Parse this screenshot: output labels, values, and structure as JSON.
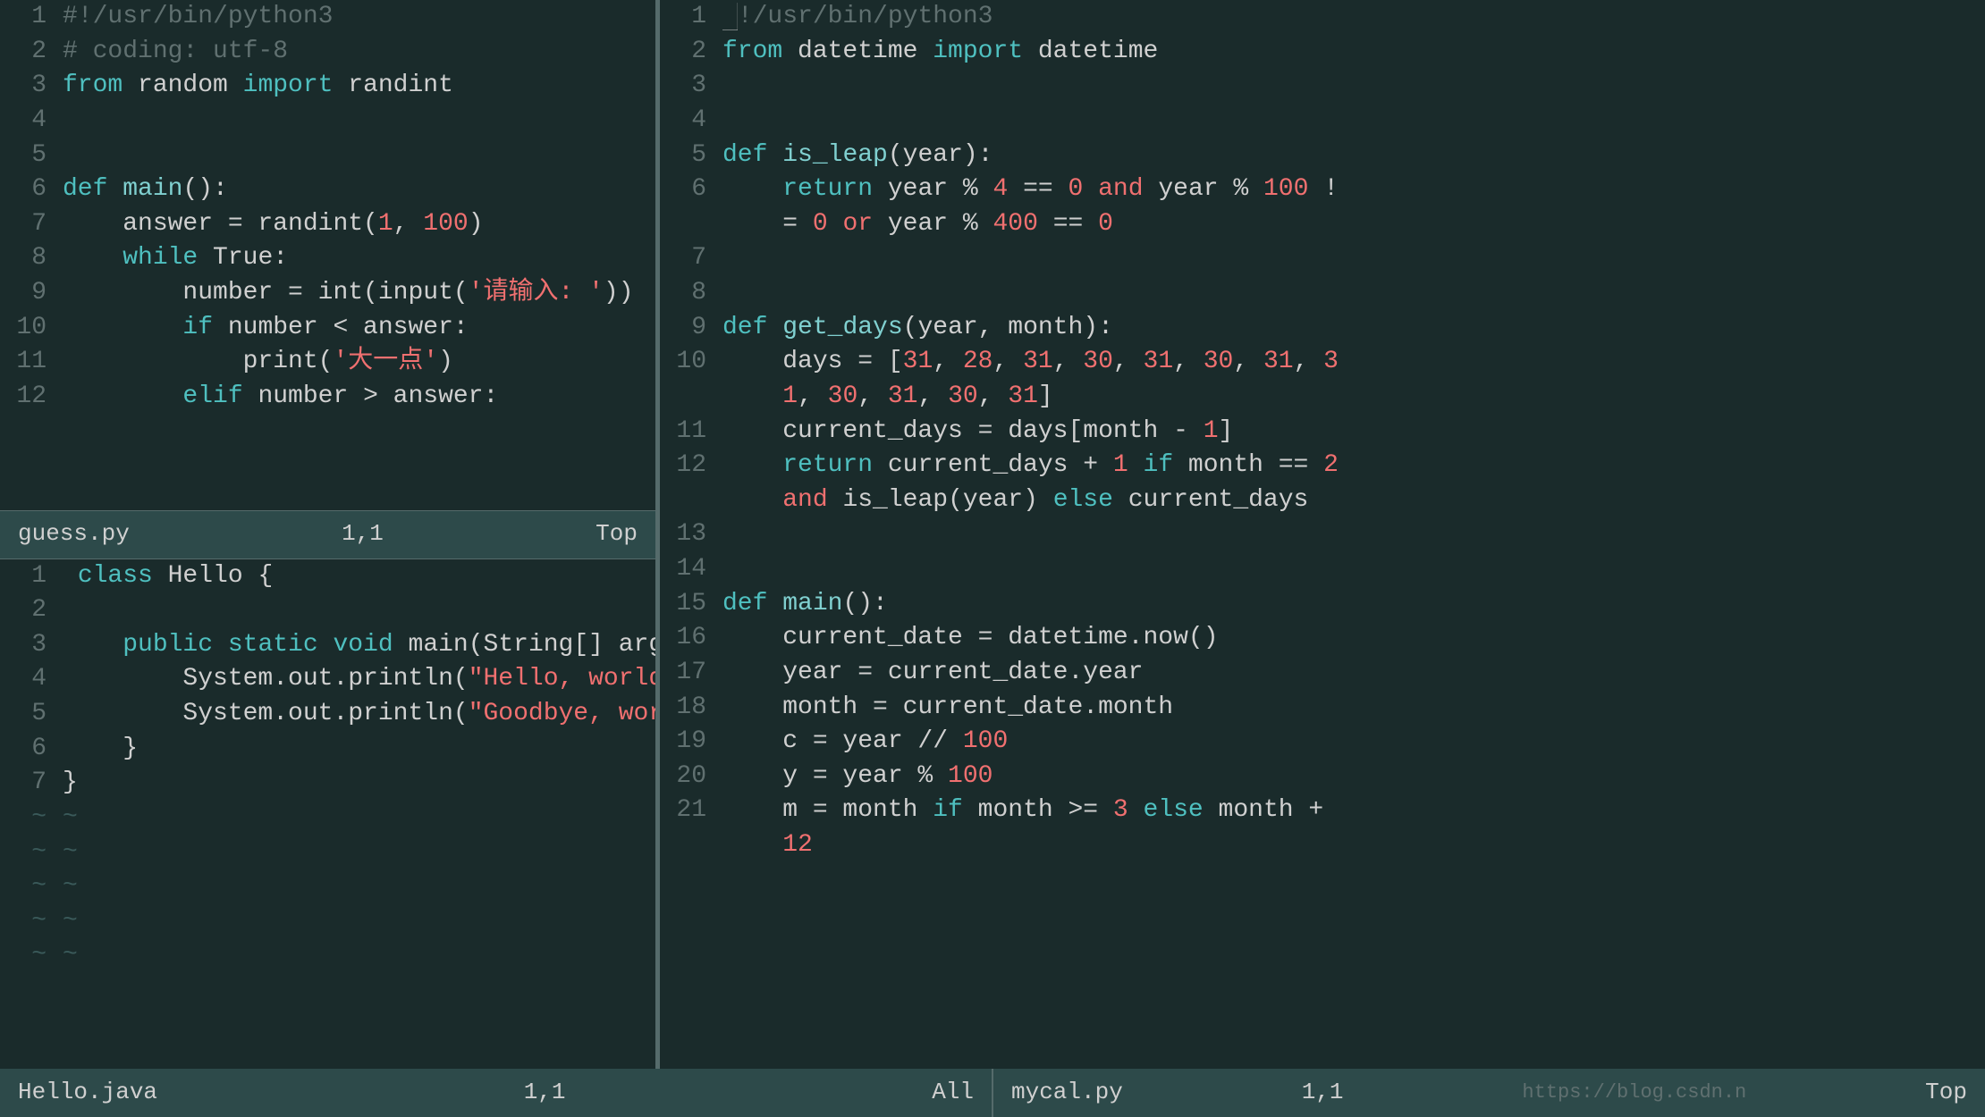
{
  "left_top": {
    "lines": [
      {
        "ln": "1",
        "tokens": [
          {
            "t": "#!/usr/bin/python3",
            "c": "c-shebang"
          }
        ]
      },
      {
        "ln": "2",
        "tokens": [
          {
            "t": "# coding: utf-8",
            "c": "c-comment"
          }
        ]
      },
      {
        "ln": "3",
        "tokens": [
          {
            "t": "from",
            "c": "c-keyword"
          },
          {
            "t": " random ",
            "c": "c-plain"
          },
          {
            "t": "import",
            "c": "c-keyword"
          },
          {
            "t": " randint",
            "c": "c-plain"
          }
        ]
      },
      {
        "ln": "4",
        "tokens": []
      },
      {
        "ln": "5",
        "tokens": []
      },
      {
        "ln": "6",
        "tokens": [
          {
            "t": "def",
            "c": "c-def"
          },
          {
            "t": " ",
            "c": "c-plain"
          },
          {
            "t": "main",
            "c": "c-funcname"
          },
          {
            "t": "():",
            "c": "c-plain"
          }
        ]
      },
      {
        "ln": "7",
        "tokens": [
          {
            "t": "    answer = randint(",
            "c": "c-plain"
          },
          {
            "t": "1",
            "c": "c-number"
          },
          {
            "t": ", ",
            "c": "c-plain"
          },
          {
            "t": "100",
            "c": "c-number"
          },
          {
            "t": ")",
            "c": "c-plain"
          }
        ]
      },
      {
        "ln": "8",
        "tokens": [
          {
            "t": "    ",
            "c": "c-plain"
          },
          {
            "t": "while",
            "c": "c-while"
          },
          {
            "t": " True:",
            "c": "c-plain"
          }
        ]
      },
      {
        "ln": "9",
        "tokens": [
          {
            "t": "        number = int(input(",
            "c": "c-plain"
          },
          {
            "t": "'请输入: '",
            "c": "c-string"
          },
          {
            "t": "))",
            "c": "c-plain"
          }
        ]
      },
      {
        "ln": "10",
        "tokens": [
          {
            "t": "        ",
            "c": "c-plain"
          },
          {
            "t": "if",
            "c": "c-if"
          },
          {
            "t": " number < answer:",
            "c": "c-plain"
          }
        ]
      },
      {
        "ln": "11",
        "tokens": [
          {
            "t": "            print(",
            "c": "c-plain"
          },
          {
            "t": "'大一点'",
            "c": "c-string"
          },
          {
            "t": ")",
            "c": "c-plain"
          }
        ]
      },
      {
        "ln": "12",
        "tokens": [
          {
            "t": "        ",
            "c": "c-plain"
          },
          {
            "t": "elif",
            "c": "c-elif"
          },
          {
            "t": " number > answer:",
            "c": "c-plain"
          }
        ]
      }
    ],
    "status": {
      "filename": "guess.py",
      "pos": "1,1",
      "scroll": "Top"
    }
  },
  "left_bottom": {
    "lines": [
      {
        "ln": "1",
        "tokens": [
          {
            "t": " ",
            "c": "c-plain"
          },
          {
            "t": "class",
            "c": "c-java-kw"
          },
          {
            "t": " Hello {",
            "c": "c-plain"
          }
        ]
      },
      {
        "ln": "2",
        "tokens": []
      },
      {
        "ln": "3",
        "tokens": [
          {
            "t": "    ",
            "c": "c-plain"
          },
          {
            "t": "public",
            "c": "c-java-kw"
          },
          {
            "t": " ",
            "c": "c-plain"
          },
          {
            "t": "static",
            "c": "c-java-kw"
          },
          {
            "t": " ",
            "c": "c-plain"
          },
          {
            "t": "void",
            "c": "c-java-type"
          },
          {
            "t": " main(String[] args) {",
            "c": "c-plain"
          }
        ]
      },
      {
        "ln": "4",
        "tokens": [
          {
            "t": "        System.out.println(",
            "c": "c-plain"
          },
          {
            "t": "\"Hello, world!\"",
            "c": "c-java-string"
          },
          {
            "t": ");",
            "c": "c-plain"
          }
        ]
      },
      {
        "ln": "5",
        "tokens": [
          {
            "t": "        System.out.println(",
            "c": "c-plain"
          },
          {
            "t": "\"Goodbye, world!\"",
            "c": "c-java-string"
          },
          {
            "t": ");",
            "c": "c-plain"
          }
        ]
      },
      {
        "ln": "6",
        "tokens": [
          {
            "t": "    }",
            "c": "c-plain"
          }
        ]
      },
      {
        "ln": "7",
        "tokens": [
          {
            "t": "}",
            "c": "c-plain"
          }
        ]
      },
      {
        "ln": "~",
        "tokens": [
          {
            "t": "~",
            "c": "c-tilde"
          }
        ]
      },
      {
        "ln": "~",
        "tokens": [
          {
            "t": "~",
            "c": "c-tilde"
          }
        ]
      },
      {
        "ln": "~",
        "tokens": [
          {
            "t": "~",
            "c": "c-tilde"
          }
        ]
      },
      {
        "ln": "~",
        "tokens": [
          {
            "t": "~",
            "c": "c-tilde"
          }
        ]
      },
      {
        "ln": "~",
        "tokens": [
          {
            "t": "~",
            "c": "c-tilde"
          }
        ]
      }
    ],
    "status": {
      "filename": "Hello.java",
      "pos": "1,1",
      "scroll": "All"
    }
  },
  "right": {
    "lines": [
      {
        "ln": "1",
        "tokens": [
          {
            "t": "█",
            "c": "cursor-block"
          },
          {
            "t": "!/usr/bin/python3",
            "c": "c-shebang"
          }
        ]
      },
      {
        "ln": "2",
        "tokens": [
          {
            "t": "from",
            "c": "c-keyword"
          },
          {
            "t": " datetime ",
            "c": "c-plain"
          },
          {
            "t": "import",
            "c": "c-keyword"
          },
          {
            "t": " datetime",
            "c": "c-plain"
          }
        ]
      },
      {
        "ln": "3",
        "tokens": []
      },
      {
        "ln": "4",
        "tokens": []
      },
      {
        "ln": "5",
        "tokens": [
          {
            "t": "def",
            "c": "c-def"
          },
          {
            "t": " ",
            "c": "c-plain"
          },
          {
            "t": "is_leap",
            "c": "c-funcname"
          },
          {
            "t": "(year):",
            "c": "c-plain"
          }
        ]
      },
      {
        "ln": "6",
        "tokens": [
          {
            "t": "    ",
            "c": "c-plain"
          },
          {
            "t": "return",
            "c": "c-return"
          },
          {
            "t": " year % ",
            "c": "c-plain"
          },
          {
            "t": "4",
            "c": "c-number"
          },
          {
            "t": " == ",
            "c": "c-plain"
          },
          {
            "t": "0",
            "c": "c-number"
          },
          {
            "t": " ",
            "c": "c-plain"
          },
          {
            "t": "and",
            "c": "c-and"
          },
          {
            "t": " year % ",
            "c": "c-plain"
          },
          {
            "t": "100",
            "c": "c-number"
          },
          {
            "t": " !",
            "c": "c-plain"
          }
        ]
      },
      {
        "ln": "wrap6",
        "tokens": [
          {
            "t": "    = ",
            "c": "c-plain"
          },
          {
            "t": "0",
            "c": "c-number"
          },
          {
            "t": " ",
            "c": "c-plain"
          },
          {
            "t": "or",
            "c": "c-or"
          },
          {
            "t": " year % ",
            "c": "c-plain"
          },
          {
            "t": "400",
            "c": "c-number"
          },
          {
            "t": " == ",
            "c": "c-plain"
          },
          {
            "t": "0",
            "c": "c-number"
          }
        ]
      },
      {
        "ln": "7",
        "tokens": []
      },
      {
        "ln": "8",
        "tokens": []
      },
      {
        "ln": "9",
        "tokens": [
          {
            "t": "def",
            "c": "c-def"
          },
          {
            "t": " ",
            "c": "c-plain"
          },
          {
            "t": "get_days",
            "c": "c-funcname"
          },
          {
            "t": "(year, month):",
            "c": "c-plain"
          }
        ]
      },
      {
        "ln": "10",
        "tokens": [
          {
            "t": "    days = [",
            "c": "c-plain"
          },
          {
            "t": "31",
            "c": "c-number"
          },
          {
            "t": ", ",
            "c": "c-plain"
          },
          {
            "t": "28",
            "c": "c-number"
          },
          {
            "t": ", ",
            "c": "c-plain"
          },
          {
            "t": "31",
            "c": "c-number"
          },
          {
            "t": ", ",
            "c": "c-plain"
          },
          {
            "t": "30",
            "c": "c-number"
          },
          {
            "t": ", ",
            "c": "c-plain"
          },
          {
            "t": "31",
            "c": "c-number"
          },
          {
            "t": ", ",
            "c": "c-plain"
          },
          {
            "t": "30",
            "c": "c-number"
          },
          {
            "t": ", ",
            "c": "c-plain"
          },
          {
            "t": "31",
            "c": "c-number"
          },
          {
            "t": ", ",
            "c": "c-plain"
          },
          {
            "t": "3",
            "c": "c-number"
          }
        ]
      },
      {
        "ln": "wrap10",
        "tokens": [
          {
            "t": "    ",
            "c": "c-plain"
          },
          {
            "t": "1",
            "c": "c-number"
          },
          {
            "t": ", ",
            "c": "c-plain"
          },
          {
            "t": "30",
            "c": "c-number"
          },
          {
            "t": ", ",
            "c": "c-plain"
          },
          {
            "t": "31",
            "c": "c-number"
          },
          {
            "t": ", ",
            "c": "c-plain"
          },
          {
            "t": "30",
            "c": "c-number"
          },
          {
            "t": ", ",
            "c": "c-plain"
          },
          {
            "t": "31",
            "c": "c-number"
          },
          {
            "t": "]",
            "c": "c-plain"
          }
        ]
      },
      {
        "ln": "11",
        "tokens": [
          {
            "t": "    current_days = days[month - ",
            "c": "c-plain"
          },
          {
            "t": "1",
            "c": "c-number"
          },
          {
            "t": "]",
            "c": "c-plain"
          }
        ]
      },
      {
        "ln": "12",
        "tokens": [
          {
            "t": "    ",
            "c": "c-plain"
          },
          {
            "t": "return",
            "c": "c-return"
          },
          {
            "t": " current_days + ",
            "c": "c-plain"
          },
          {
            "t": "1",
            "c": "c-number"
          },
          {
            "t": " ",
            "c": "c-plain"
          },
          {
            "t": "if",
            "c": "c-if"
          },
          {
            "t": " month == ",
            "c": "c-plain"
          },
          {
            "t": "2",
            "c": "c-number"
          }
        ]
      },
      {
        "ln": "wrap12",
        "tokens": [
          {
            "t": "    ",
            "c": "c-and"
          },
          {
            "t": "and",
            "c": "c-and"
          },
          {
            "t": " is_leap(year) ",
            "c": "c-plain"
          },
          {
            "t": "else",
            "c": "c-else"
          },
          {
            "t": " current_days",
            "c": "c-plain"
          }
        ]
      },
      {
        "ln": "13",
        "tokens": []
      },
      {
        "ln": "14",
        "tokens": []
      },
      {
        "ln": "15",
        "tokens": [
          {
            "t": "def",
            "c": "c-def"
          },
          {
            "t": " ",
            "c": "c-plain"
          },
          {
            "t": "main",
            "c": "c-funcname"
          },
          {
            "t": "():",
            "c": "c-plain"
          }
        ]
      },
      {
        "ln": "16",
        "tokens": [
          {
            "t": "    current_date = datetime.now()",
            "c": "c-plain"
          }
        ]
      },
      {
        "ln": "17",
        "tokens": [
          {
            "t": "    year = current_date.year",
            "c": "c-plain"
          }
        ]
      },
      {
        "ln": "18",
        "tokens": [
          {
            "t": "    month = current_date.month",
            "c": "c-plain"
          }
        ]
      },
      {
        "ln": "19",
        "tokens": [
          {
            "t": "    c = year // ",
            "c": "c-plain"
          },
          {
            "t": "100",
            "c": "c-number"
          }
        ]
      },
      {
        "ln": "20",
        "tokens": [
          {
            "t": "    y = year % ",
            "c": "c-plain"
          },
          {
            "t": "100",
            "c": "c-number"
          }
        ]
      },
      {
        "ln": "21",
        "tokens": [
          {
            "t": "    m = month ",
            "c": "c-plain"
          },
          {
            "t": "if",
            "c": "c-if"
          },
          {
            "t": " month >= ",
            "c": "c-plain"
          },
          {
            "t": "3",
            "c": "c-number"
          },
          {
            "t": " ",
            "c": "c-plain"
          },
          {
            "t": "else",
            "c": "c-else"
          },
          {
            "t": " month +",
            "c": "c-plain"
          }
        ]
      },
      {
        "ln": "wrap21",
        "tokens": [
          {
            "t": "    ",
            "c": "c-plain"
          },
          {
            "t": "12",
            "c": "c-number"
          }
        ]
      }
    ],
    "status": {
      "filename": "mycal.py",
      "pos": "1,1",
      "scroll": "Top",
      "url": "https://blog.csdn.n"
    }
  }
}
